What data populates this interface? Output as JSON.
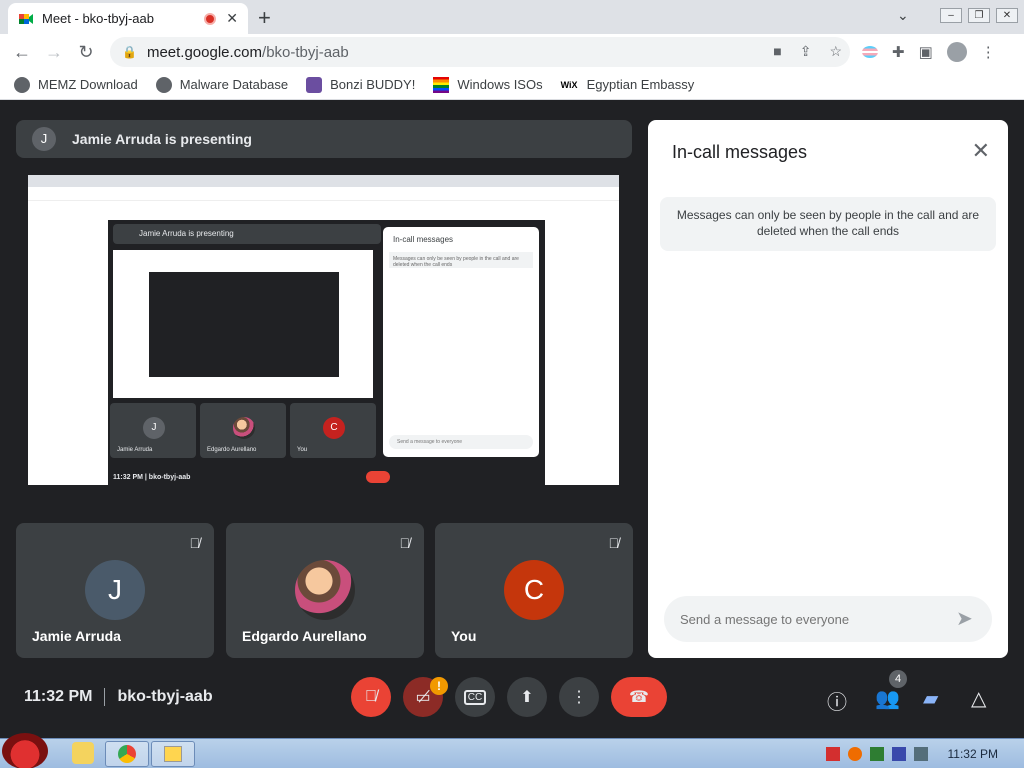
{
  "browser": {
    "tab_title": "Meet - bko-tbyj-aab",
    "new_tab_symbol": "+",
    "url_host": "meet.google.com",
    "url_path": "/bko-tbyj-aab",
    "bookmarks": [
      {
        "label": "MEMZ Download",
        "icon": "globe-icon"
      },
      {
        "label": "Malware Database",
        "icon": "globe-icon"
      },
      {
        "label": "Bonzi BUDDY!",
        "icon": "bonzi-icon"
      },
      {
        "label": "Windows ISOs",
        "icon": "rainbow-flag-icon"
      },
      {
        "label": "Egyptian Embassy",
        "icon": "wix-icon"
      }
    ],
    "wix_text": "WiX"
  },
  "meet": {
    "presenting_avatar": "J",
    "presenting_text": "Jamie Arruda is presenting",
    "shared_screen": {
      "inner_presenting": "Jamie Arruda is presenting",
      "inner_chat_title": "In-call messages",
      "inner_chat_note": "Messages can only be seen by people in the call and are deleted when the call ends",
      "inner_chat_input": "Send a message to everyone",
      "inner_tiles": [
        {
          "name": "Jamie Arruda",
          "initial": "J",
          "color": "#5f6368"
        },
        {
          "name": "Edgardo Aurellano",
          "initial": "",
          "color": "#c94f7c"
        },
        {
          "name": "You",
          "initial": "C",
          "color": "#c5221f"
        }
      ],
      "inner_footer": "11:32 PM  |  bko-tbyj-aab"
    },
    "tiles": [
      {
        "name": "Jamie Arruda",
        "initial": "J",
        "color": "#4a5a6a"
      },
      {
        "name": "Edgardo Aurellano",
        "initial": "",
        "color": "#c94f7c"
      },
      {
        "name": "You",
        "initial": "C",
        "color": "#c5360c"
      }
    ],
    "chat": {
      "title": "In-call messages",
      "note": "Messages can only be seen by people in the call and are deleted when the call ends",
      "input_placeholder": "Send a message to everyone"
    },
    "footer": {
      "time": "11:32 PM",
      "meeting_code": "bko-tbyj-aab",
      "camera_badge": "!",
      "participant_count": "4"
    },
    "colors": {
      "end_call": "#ea4335",
      "accent_blue": "#8ab4f8"
    }
  },
  "taskbar": {
    "clock": "11:32 PM"
  }
}
